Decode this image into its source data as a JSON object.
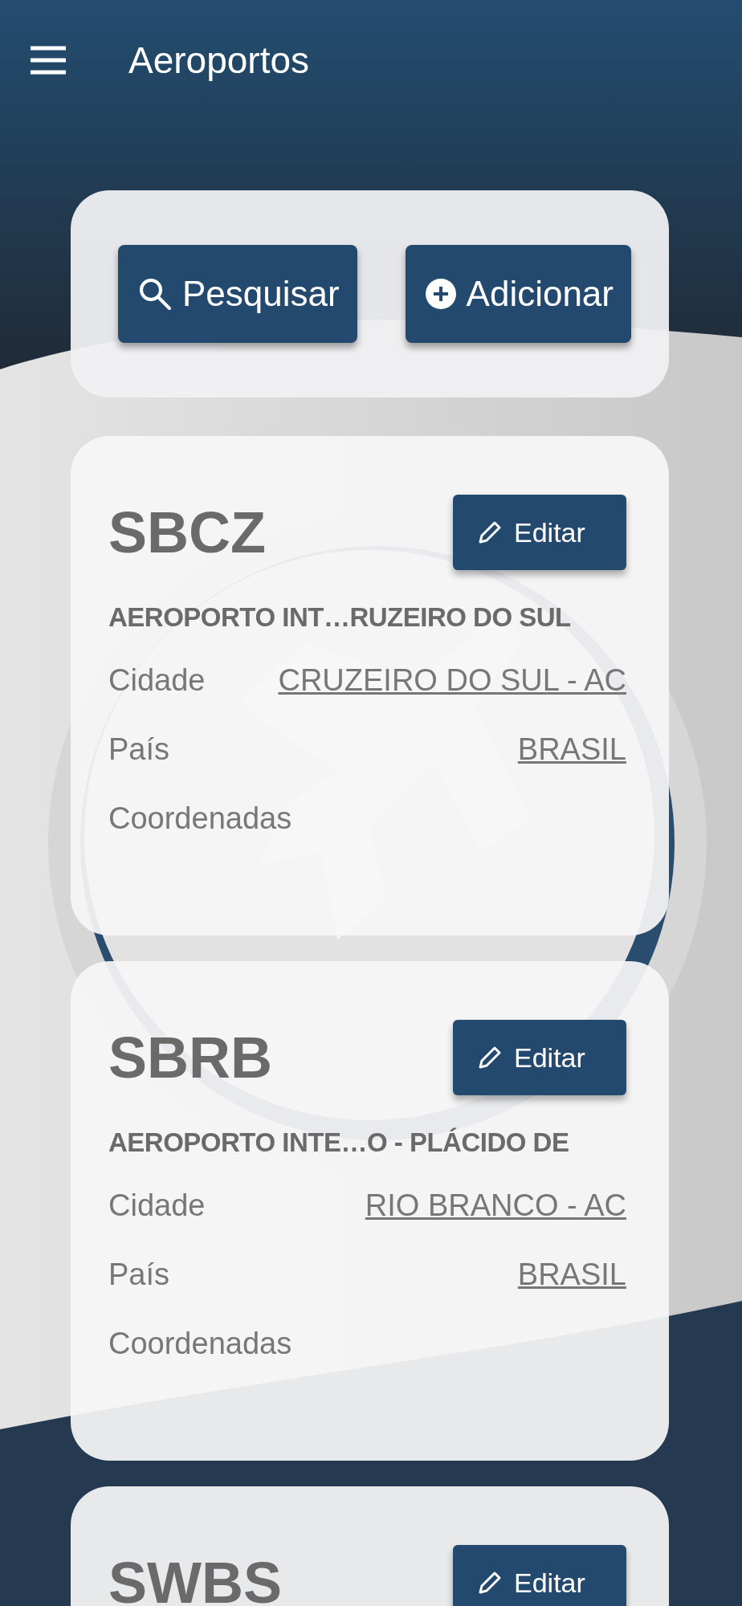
{
  "header": {
    "title": "Aeroportos"
  },
  "actions": [
    {
      "kind": "search",
      "label": "Pesquisar"
    },
    {
      "kind": "add",
      "label": "Adicionar"
    }
  ],
  "airports": [
    {
      "code": "SBCZ",
      "edit_label": "Editar",
      "name": "AEROPORTO INT…RUZEIRO DO SUL",
      "fields": [
        {
          "label": "Cidade",
          "value": "CRUZEIRO DO SUL - AC"
        },
        {
          "label": "País",
          "value": "BRASIL"
        },
        {
          "label": "Coordenadas"
        }
      ]
    },
    {
      "code": "SBRB",
      "edit_label": "Editar",
      "name": "AEROPORTO INTE…O - PLÁCIDO DE",
      "fields": [
        {
          "label": "Cidade",
          "value": "RIO BRANCO - AC"
        },
        {
          "label": "País",
          "value": "BRASIL"
        },
        {
          "label": "Coordenadas"
        }
      ]
    },
    {
      "code": "SWBS",
      "edit_label": "Editar"
    }
  ]
}
